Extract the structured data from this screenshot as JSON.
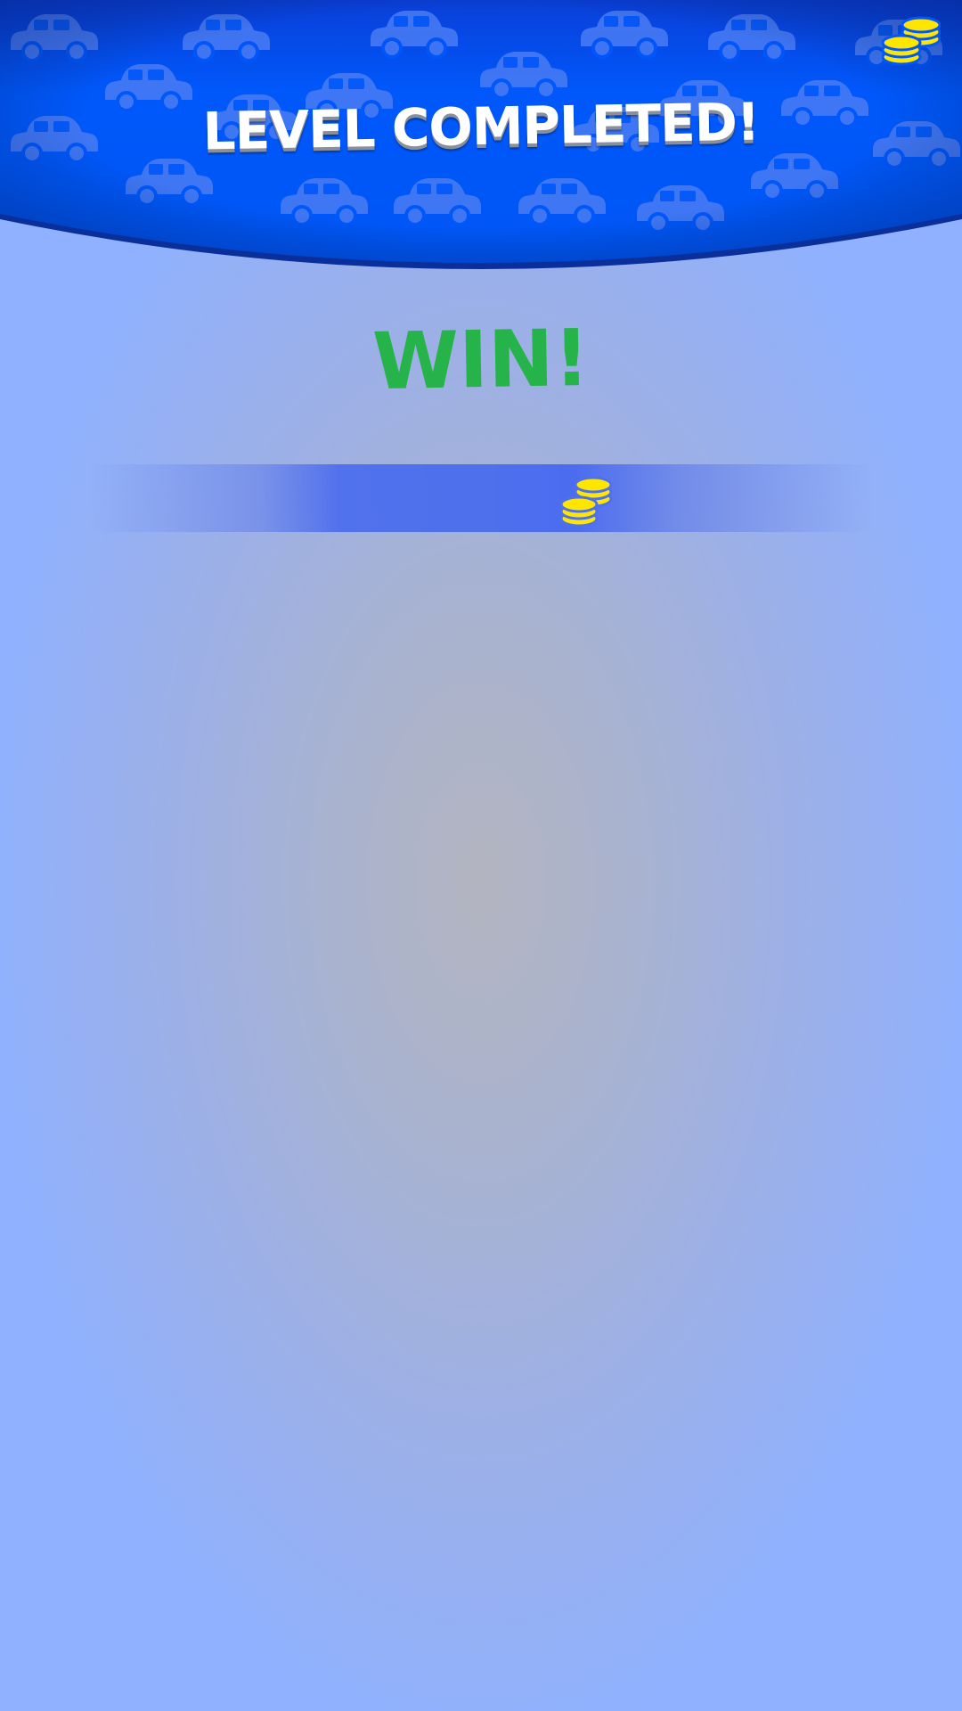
{
  "header": {
    "title": "LEVEL COMPLETED!",
    "background_color": "#0057fa",
    "pattern_icon": "car-icon",
    "coins_icon": "coin-stack-icon"
  },
  "result": {
    "text": "WIN!",
    "color": "#26b34a"
  },
  "reward": {
    "icon": "coin-stack-icon",
    "strip_color": "#4e70ec",
    "coin_color": "#ffe600"
  }
}
